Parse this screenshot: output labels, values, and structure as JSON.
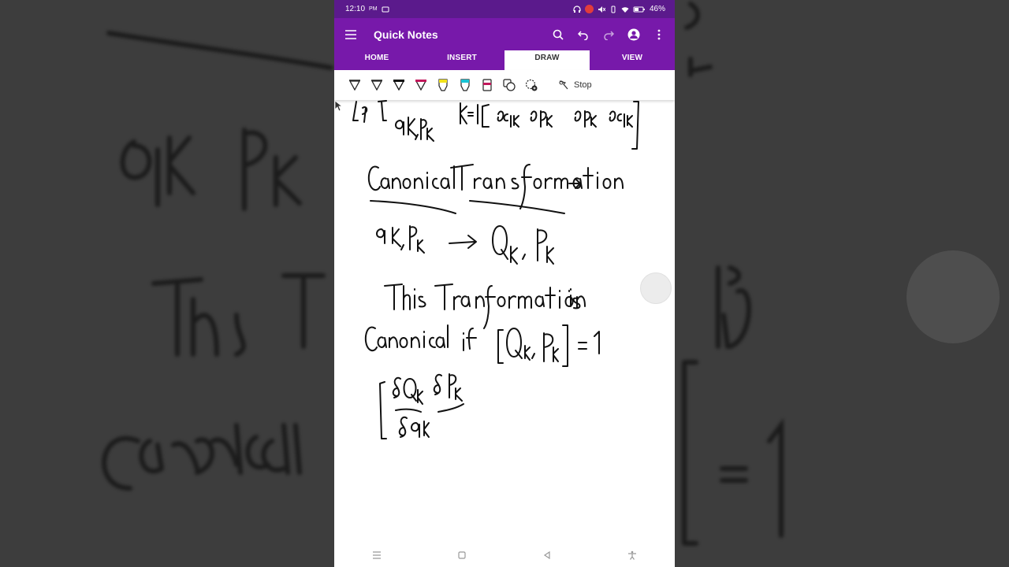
{
  "status_bar": {
    "time": "12:10",
    "ampm": "PM",
    "battery": "46%"
  },
  "app_bar": {
    "title": "Quick Notes",
    "icons": [
      "menu-icon",
      "search-icon",
      "undo-icon",
      "redo-icon",
      "account-icon",
      "more-icon"
    ]
  },
  "tabs": [
    {
      "label": "HOME"
    },
    {
      "label": "INSERT"
    },
    {
      "label": "DRAW",
      "active": true
    },
    {
      "label": "VIEW"
    }
  ],
  "toolbar": {
    "tools": [
      "pen-black-outline",
      "pen-black-outline-2",
      "pen-black",
      "pen-magenta",
      "highlighter-yellow",
      "highlighter-cyan",
      "highlighter-magenta",
      "shapes-icon",
      "add-shape-icon"
    ],
    "stop_label": "Stop"
  },
  "colors": {
    "accent": "#7719aa",
    "status": "#5b1a8c",
    "ink": "#111111"
  }
}
